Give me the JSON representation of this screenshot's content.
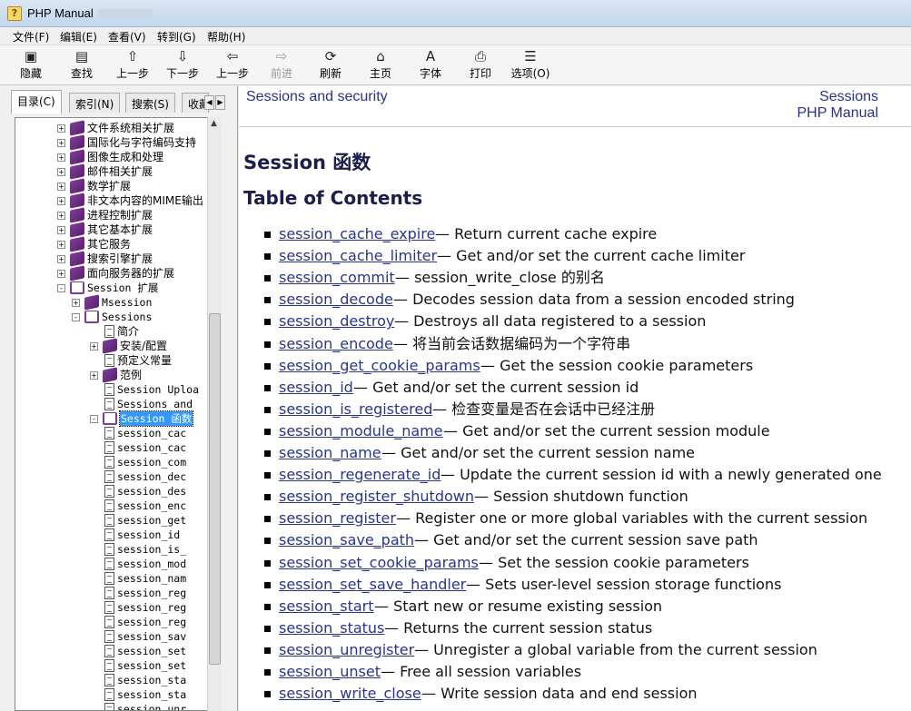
{
  "window": {
    "title": "PHP Manual"
  },
  "menu": [
    "文件(F)",
    "编辑(E)",
    "查看(V)",
    "转到(G)",
    "帮助(H)"
  ],
  "toolbar": [
    {
      "label": "隐藏",
      "icon": "hide-icon",
      "glyph": "▣",
      "disabled": false
    },
    {
      "label": "查找",
      "icon": "find-icon",
      "glyph": "▤",
      "disabled": false
    },
    {
      "label": "上一步",
      "icon": "up-arrow-icon",
      "glyph": "⇧",
      "disabled": false
    },
    {
      "label": "下一步",
      "icon": "down-arrow-icon",
      "glyph": "⇩",
      "disabled": false
    },
    {
      "label": "上一步",
      "icon": "back-arrow-icon",
      "glyph": "⇦",
      "disabled": false
    },
    {
      "label": "前进",
      "icon": "forward-arrow-icon",
      "glyph": "⇨",
      "disabled": true
    },
    {
      "label": "刷新",
      "icon": "refresh-icon",
      "glyph": "⟳",
      "disabled": false
    },
    {
      "label": "主页",
      "icon": "home-icon",
      "glyph": "⌂",
      "disabled": false
    },
    {
      "label": "字体",
      "icon": "font-icon",
      "glyph": "A",
      "disabled": false
    },
    {
      "label": "打印",
      "icon": "print-icon",
      "glyph": "⎙",
      "disabled": false
    },
    {
      "label": "选项(O)",
      "icon": "options-icon",
      "glyph": "☰",
      "disabled": false
    }
  ],
  "tabs": [
    {
      "label": "目录(C)",
      "active": true
    },
    {
      "label": "索引(N)",
      "active": false
    },
    {
      "label": "搜索(S)",
      "active": false
    },
    {
      "label": "收藏",
      "active": false
    }
  ],
  "tree": [
    {
      "text": "文件系统相关扩展",
      "level": 0,
      "kind": "book",
      "exp": "+"
    },
    {
      "text": "国际化与字符编码支持",
      "level": 0,
      "kind": "book",
      "exp": "+"
    },
    {
      "text": "图像生成和处理",
      "level": 0,
      "kind": "book",
      "exp": "+"
    },
    {
      "text": "邮件相关扩展",
      "level": 0,
      "kind": "book",
      "exp": "+"
    },
    {
      "text": "数学扩展",
      "level": 0,
      "kind": "book",
      "exp": "+"
    },
    {
      "text": "非文本内容的MIME输出",
      "level": 0,
      "kind": "book",
      "exp": "+"
    },
    {
      "text": "进程控制扩展",
      "level": 0,
      "kind": "book",
      "exp": "+"
    },
    {
      "text": "其它基本扩展",
      "level": 0,
      "kind": "book",
      "exp": "+"
    },
    {
      "text": "其它服务",
      "level": 0,
      "kind": "book",
      "exp": "+"
    },
    {
      "text": "搜索引擎扩展",
      "level": 0,
      "kind": "book",
      "exp": "+"
    },
    {
      "text": "面向服务器的扩展",
      "level": 0,
      "kind": "book",
      "exp": "+"
    },
    {
      "text": "Session 扩展",
      "level": 0,
      "kind": "openbook",
      "exp": "-"
    },
    {
      "text": "Msession",
      "level": 1,
      "kind": "book",
      "exp": "+"
    },
    {
      "text": "Sessions",
      "level": 1,
      "kind": "openbook",
      "exp": "-"
    },
    {
      "text": "简介",
      "level": 2,
      "kind": "page",
      "exp": ""
    },
    {
      "text": "安装/配置",
      "level": 2,
      "kind": "book",
      "exp": "+"
    },
    {
      "text": "预定义常量",
      "level": 2,
      "kind": "page",
      "exp": ""
    },
    {
      "text": "范例",
      "level": 2,
      "kind": "book",
      "exp": "+"
    },
    {
      "text": "Session Uploa",
      "level": 2,
      "kind": "page",
      "exp": ""
    },
    {
      "text": "Sessions and",
      "level": 2,
      "kind": "page",
      "exp": ""
    },
    {
      "text": "Session 函数",
      "level": 2,
      "kind": "openbook",
      "exp": "-",
      "selected": true
    },
    {
      "text": "session_cac",
      "level": 3,
      "kind": "page",
      "exp": ""
    },
    {
      "text": "session_cac",
      "level": 3,
      "kind": "page",
      "exp": ""
    },
    {
      "text": "session_com",
      "level": 3,
      "kind": "page",
      "exp": ""
    },
    {
      "text": "session_dec",
      "level": 3,
      "kind": "page",
      "exp": ""
    },
    {
      "text": "session_des",
      "level": 3,
      "kind": "page",
      "exp": ""
    },
    {
      "text": "session_enc",
      "level": 3,
      "kind": "page",
      "exp": ""
    },
    {
      "text": "session_get",
      "level": 3,
      "kind": "page",
      "exp": ""
    },
    {
      "text": "session_id",
      "level": 3,
      "kind": "page",
      "exp": ""
    },
    {
      "text": "session_is_",
      "level": 3,
      "kind": "page",
      "exp": ""
    },
    {
      "text": "session_mod",
      "level": 3,
      "kind": "page",
      "exp": ""
    },
    {
      "text": "session_nam",
      "level": 3,
      "kind": "page",
      "exp": ""
    },
    {
      "text": "session_reg",
      "level": 3,
      "kind": "page",
      "exp": ""
    },
    {
      "text": "session_reg",
      "level": 3,
      "kind": "page",
      "exp": ""
    },
    {
      "text": "session_reg",
      "level": 3,
      "kind": "page",
      "exp": ""
    },
    {
      "text": "session_sav",
      "level": 3,
      "kind": "page",
      "exp": ""
    },
    {
      "text": "session_set",
      "level": 3,
      "kind": "page",
      "exp": ""
    },
    {
      "text": "session_set",
      "level": 3,
      "kind": "page",
      "exp": ""
    },
    {
      "text": "session_sta",
      "level": 3,
      "kind": "page",
      "exp": ""
    },
    {
      "text": "session_sta",
      "level": 3,
      "kind": "page",
      "exp": ""
    },
    {
      "text": "session_unr",
      "level": 3,
      "kind": "page",
      "exp": ""
    }
  ],
  "nav": {
    "prev": "Sessions and security",
    "up": "Sessions",
    "home": "PHP Manual"
  },
  "content": {
    "heading": "Session 函数",
    "toc_title": "Table of Contents",
    "items": [
      {
        "fn": "session_cache_expire",
        "desc": "Return current cache expire"
      },
      {
        "fn": "session_cache_limiter",
        "desc": "Get and/or set the current cache limiter"
      },
      {
        "fn": "session_commit",
        "desc": "session_write_close 的别名"
      },
      {
        "fn": "session_decode",
        "desc": "Decodes session data from a session encoded string"
      },
      {
        "fn": "session_destroy",
        "desc": "Destroys all data registered to a session"
      },
      {
        "fn": "session_encode",
        "desc": "将当前会话数据编码为一个字符串"
      },
      {
        "fn": "session_get_cookie_params",
        "desc": "Get the session cookie parameters"
      },
      {
        "fn": "session_id",
        "desc": "Get and/or set the current session id"
      },
      {
        "fn": "session_is_registered",
        "desc": "检查变量是否在会话中已经注册"
      },
      {
        "fn": "session_module_name",
        "desc": "Get and/or set the current session module"
      },
      {
        "fn": "session_name",
        "desc": "Get and/or set the current session name"
      },
      {
        "fn": "session_regenerate_id",
        "desc": "Update the current session id with a newly generated one"
      },
      {
        "fn": "session_register_shutdown",
        "desc": "Session shutdown function"
      },
      {
        "fn": "session_register",
        "desc": "Register one or more global variables with the current session"
      },
      {
        "fn": "session_save_path",
        "desc": "Get and/or set the current session save path"
      },
      {
        "fn": "session_set_cookie_params",
        "desc": "Set the session cookie parameters"
      },
      {
        "fn": "session_set_save_handler",
        "desc": "Sets user-level session storage functions"
      },
      {
        "fn": "session_start",
        "desc": "Start new or resume existing session"
      },
      {
        "fn": "session_status",
        "desc": "Returns the current session status"
      },
      {
        "fn": "session_unregister",
        "desc": "Unregister a global variable from the current session"
      },
      {
        "fn": "session_unset",
        "desc": "Free all session variables"
      },
      {
        "fn": "session_write_close",
        "desc": "Write session data and end session"
      }
    ]
  },
  "colors": {
    "link": "#29348f",
    "heading": "#1b1e4b",
    "selection": "#3399ff"
  }
}
